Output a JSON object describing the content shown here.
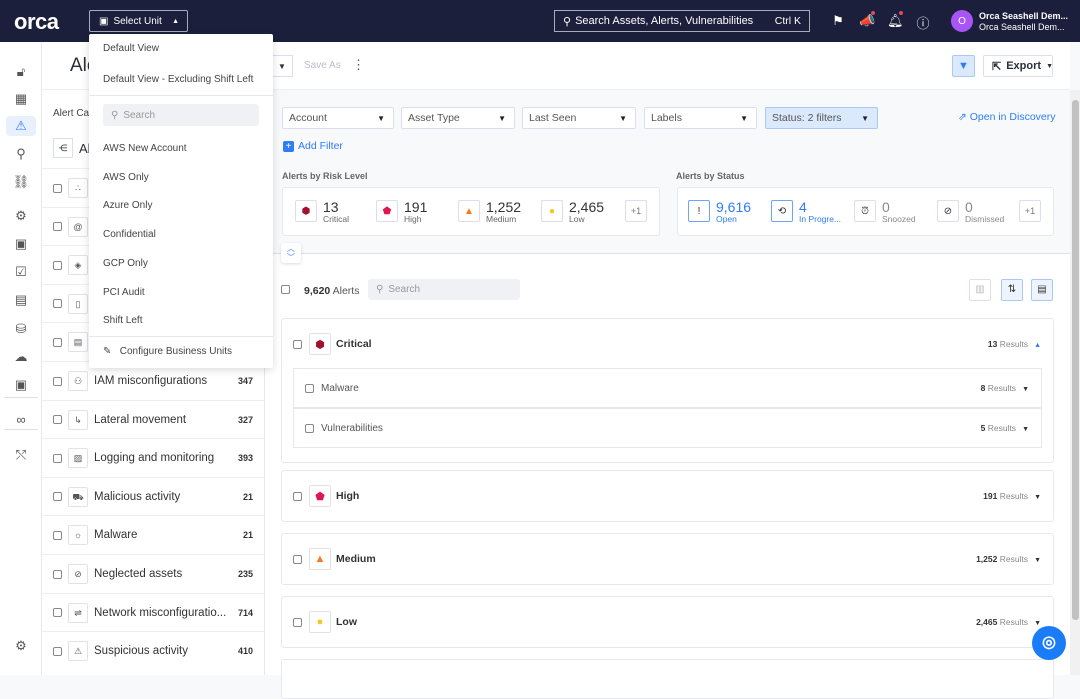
{
  "topbar": {
    "logo": "orca",
    "unit_button": "Select Unit",
    "search_placeholder": "Search Assets, Alerts, Vulnerabilities",
    "search_shortcut": "Ctrl K",
    "avatar_initial": "O",
    "user_name": "Orca Seashell Dem...",
    "user_org": "Orca Seashell Dem..."
  },
  "unit_dropdown": {
    "views": [
      "Default View",
      "Default View - Excluding Shift Left"
    ],
    "search_placeholder": "Search",
    "units": [
      "AWS New Account",
      "AWS Only",
      "Azure Only",
      "Confidential",
      "GCP Only",
      "PCI Audit",
      "Shift Left"
    ],
    "configure": "Configure Business Units"
  },
  "header": {
    "title": "Alerts",
    "save_as": "Save As",
    "export": "Export"
  },
  "categories": {
    "title": "Alert Categories",
    "all_label": "All",
    "items": [
      {
        "label": "",
        "count": ""
      },
      {
        "label": "",
        "count": ""
      },
      {
        "label": "",
        "count": ""
      },
      {
        "label": "",
        "count": ""
      },
      {
        "label": "",
        "count": ""
      },
      {
        "label": "IAM misconfigurations",
        "count": "347"
      },
      {
        "label": "Lateral movement",
        "count": "327"
      },
      {
        "label": "Logging and monitoring",
        "count": "393"
      },
      {
        "label": "Malicious activity",
        "count": "21"
      },
      {
        "label": "Malware",
        "count": "21"
      },
      {
        "label": "Neglected assets",
        "count": "235"
      },
      {
        "label": "Network misconfiguratio...",
        "count": "714"
      },
      {
        "label": "Suspicious activity",
        "count": "410"
      }
    ]
  },
  "filters": {
    "items": [
      "Account",
      "Asset Type",
      "Last Seen",
      "Labels",
      "Status: 2 filters"
    ],
    "add_filter": "Add Filter",
    "open_discovery": "Open in Discovery"
  },
  "risk": {
    "title": "Alerts by Risk Level",
    "items": [
      {
        "value": "13",
        "label": "Critical",
        "color": "#a3102f"
      },
      {
        "value": "191",
        "label": "High",
        "color": "#e0164f"
      },
      {
        "value": "1,252",
        "label": "Medium",
        "color": "#f7781d"
      },
      {
        "value": "2,465",
        "label": "Low",
        "color": "#f5c518"
      }
    ],
    "more": "+1"
  },
  "status": {
    "title": "Alerts by Status",
    "items": [
      {
        "value": "9,616",
        "label": "Open"
      },
      {
        "value": "4",
        "label": "In Progre..."
      },
      {
        "value": "0",
        "label": "Snoozed"
      },
      {
        "value": "0",
        "label": "Dismissed"
      }
    ],
    "more": "+1"
  },
  "list": {
    "count": "9,620",
    "count_label": "Alerts",
    "search_placeholder": "Search",
    "results_word": "Results",
    "groups": [
      {
        "label": "Critical",
        "count": "13",
        "subs": [
          {
            "label": "Malware",
            "count": "8"
          },
          {
            "label": "Vulnerabilities",
            "count": "5"
          }
        ]
      },
      {
        "label": "High",
        "count": "191"
      },
      {
        "label": "Medium",
        "count": "1,252"
      },
      {
        "label": "Low",
        "count": "2,465"
      }
    ]
  },
  "accent": "#2e7cf6"
}
